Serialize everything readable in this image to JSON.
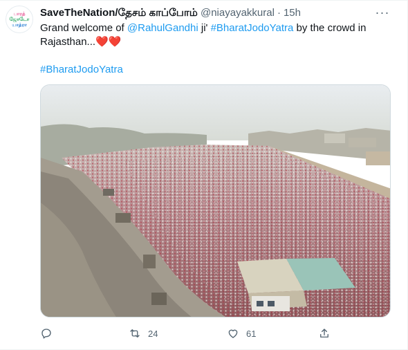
{
  "account": {
    "display_name": "SaveTheNation/தேசம் காப்போம்",
    "handle": "@niayayakkural",
    "time": "15h",
    "avatar_lines": [
      "பாரத்",
      "ஜோடோ",
      "யாத்ரா"
    ]
  },
  "tweet": {
    "text_before": "Grand welcome of ",
    "mention": "@RahulGandhi",
    "text_mid": " ji' ",
    "hashtag_inline": "#BharatJodoYatra",
    "text_after": " by the crowd in Rajasthan...",
    "emoji": "❤️❤️",
    "hashtag_line": "#BharatJodoYatra"
  },
  "media": {
    "description_icon": "photo"
  },
  "actions": {
    "reply_icon": "reply-icon",
    "retweet_icon": "retweet-icon",
    "retweet_count": "24",
    "like_icon": "heart-icon",
    "like_count": "61",
    "share_icon": "share-icon"
  },
  "colors": {
    "link": "#1d9bf0",
    "secondary_text": "#536471",
    "heart": "#e0245e"
  }
}
